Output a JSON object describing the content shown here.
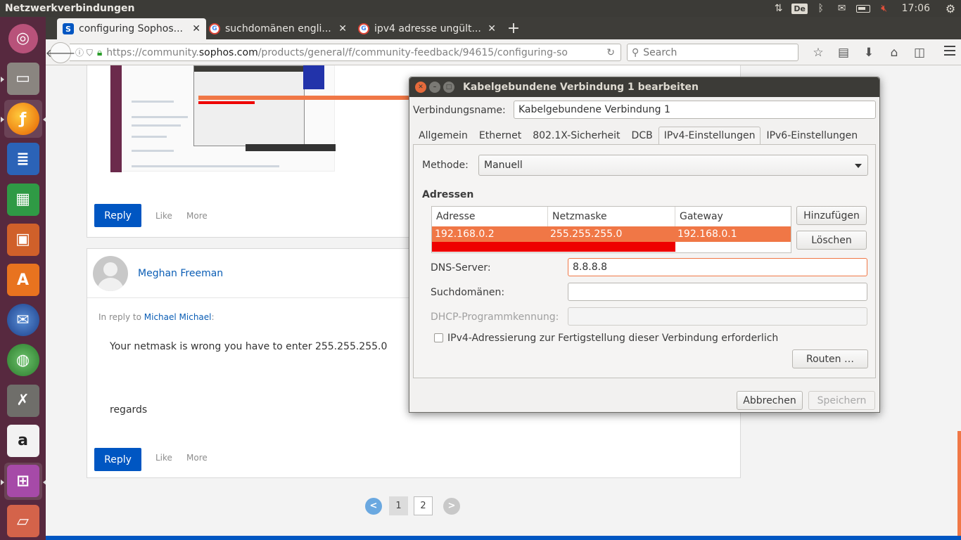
{
  "topbar": {
    "title": "Netzwerkverbindungen",
    "keyboard_layout": "De",
    "clock": "17:06",
    "colors": {
      "panel": "#3c3b37",
      "mute": "#e0503b"
    },
    "icons": [
      "network-updown-icon",
      "keyboard-layout-icon",
      "bluetooth-icon",
      "mail-icon",
      "battery-icon",
      "volume-muted-icon",
      "power-gear-icon"
    ]
  },
  "launcher": {
    "color": "#57293f",
    "items": [
      {
        "name": "ubuntu-dash-icon"
      },
      {
        "name": "files-icon"
      },
      {
        "name": "firefox-icon"
      },
      {
        "name": "writer-icon"
      },
      {
        "name": "calc-icon"
      },
      {
        "name": "impress-icon"
      },
      {
        "name": "software-center-icon"
      },
      {
        "name": "thunderbird-icon"
      },
      {
        "name": "network-globe-icon"
      },
      {
        "name": "system-settings-icon"
      },
      {
        "name": "amazon-icon"
      },
      {
        "name": "network-connections-icon"
      },
      {
        "name": "trash-icon"
      }
    ]
  },
  "browser": {
    "tabs": [
      {
        "label": "configuring Sophos...",
        "active": true,
        "favicon": "S"
      },
      {
        "label": "suchdomänen engli...",
        "active": false,
        "favicon": "G"
      },
      {
        "label": "ipv4 adresse ungült...",
        "active": false,
        "favicon": "G"
      }
    ],
    "url_prefix": "https://community.",
    "url_domain": "sophos.com",
    "url_path": "/products/general/f/community-feedback/94615/configuring-so",
    "search_placeholder": "Search"
  },
  "page": {
    "post1": {
      "reply": "Reply",
      "like": "Like",
      "more": "More"
    },
    "post2": {
      "author": "Meghan Freeman",
      "in_reply_prefix": "In reply to",
      "in_reply_name": "Michael Michael",
      "in_reply_suffix": ":",
      "body_line1": "Your netmask is wrong you have to enter 255.255.255.0",
      "body_line2": "regards",
      "reply": "Reply",
      "like": "Like",
      "more": "More"
    },
    "pagination": {
      "prev": "<",
      "pages": [
        "1",
        "2"
      ],
      "current": "1",
      "next": ">"
    },
    "colors": {
      "accent": "#0056c2",
      "link": "#0a5db5"
    }
  },
  "dialog": {
    "title": "Kabelgebundene Verbindung 1 bearbeiten",
    "conn_name_label": "Verbindungsname:",
    "conn_name_value": "Kabelgebundene Verbindung 1",
    "tabs": [
      "Allgemein",
      "Ethernet",
      "802.1X-Sicherheit",
      "DCB",
      "IPv4-Einstellungen",
      "IPv6-Einstellungen"
    ],
    "active_tab": "IPv4-Einstellungen",
    "method_label": "Methode:",
    "method_value": "Manuell",
    "addresses_label": "Adressen",
    "table": {
      "columns": [
        "Adresse",
        "Netzmaske",
        "Gateway"
      ],
      "rows": [
        [
          "192.168.0.2",
          "255.255.255.0",
          "192.168.0.1"
        ]
      ]
    },
    "add_button": "Hinzufügen",
    "delete_button": "Löschen",
    "dns_label": "DNS-Server:",
    "dns_value": "8.8.8.8",
    "search_domains_label": "Suchdomänen:",
    "search_domains_value": "",
    "dhcp_label": "DHCP-Programmkennung:",
    "dhcp_value": "",
    "require_ipv4_label": "IPv4-Adressierung zur Fertigstellung dieser Verbindung erforderlich",
    "require_ipv4_checked": false,
    "routes_button": "Routen …",
    "cancel_button": "Abbrechen",
    "save_button": "Speichern",
    "colors": {
      "selection": "#f07746",
      "error": "#ee0000"
    }
  }
}
